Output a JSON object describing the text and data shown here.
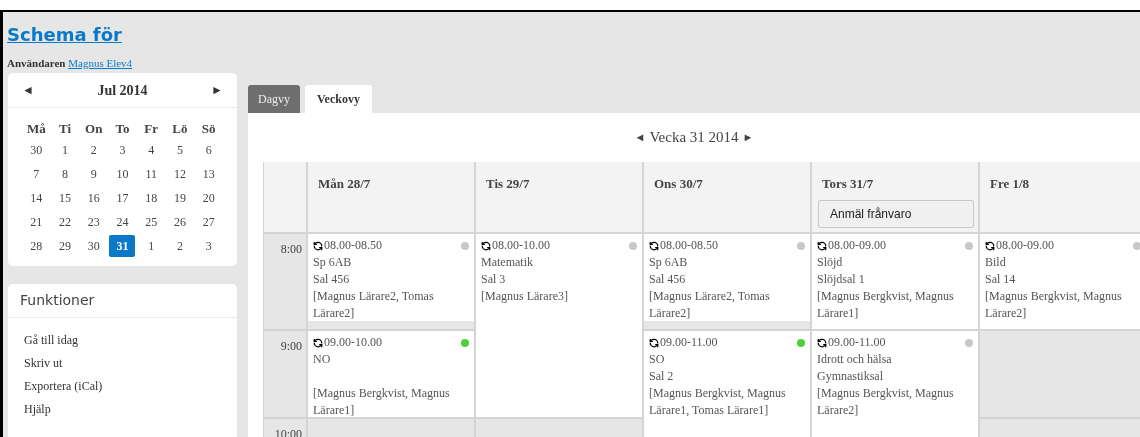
{
  "page": {
    "title": "Schema för",
    "user_label": "Användaren",
    "user_link": "Magnus Elev4"
  },
  "mini_calendar": {
    "prev": "◄",
    "month": "Jul 2014",
    "next": "►",
    "weekdays": [
      "Må",
      "Ti",
      "On",
      "To",
      "Fr",
      "Lö",
      "Sö"
    ],
    "weeks": [
      [
        {
          "day": "30",
          "selected": false
        },
        {
          "day": "1",
          "selected": false
        },
        {
          "day": "2",
          "selected": false
        },
        {
          "day": "3",
          "selected": false
        },
        {
          "day": "4",
          "selected": false
        },
        {
          "day": "5",
          "selected": false
        },
        {
          "day": "6",
          "selected": false
        }
      ],
      [
        {
          "day": "7",
          "selected": false
        },
        {
          "day": "8",
          "selected": false
        },
        {
          "day": "9",
          "selected": false
        },
        {
          "day": "10",
          "selected": false
        },
        {
          "day": "11",
          "selected": false
        },
        {
          "day": "12",
          "selected": false
        },
        {
          "day": "13",
          "selected": false
        }
      ],
      [
        {
          "day": "14",
          "selected": false
        },
        {
          "day": "15",
          "selected": false
        },
        {
          "day": "16",
          "selected": false
        },
        {
          "day": "17",
          "selected": false
        },
        {
          "day": "18",
          "selected": false
        },
        {
          "day": "19",
          "selected": false
        },
        {
          "day": "20",
          "selected": false
        }
      ],
      [
        {
          "day": "21",
          "selected": false
        },
        {
          "day": "22",
          "selected": false
        },
        {
          "day": "23",
          "selected": false
        },
        {
          "day": "24",
          "selected": false
        },
        {
          "day": "25",
          "selected": false
        },
        {
          "day": "26",
          "selected": false
        },
        {
          "day": "27",
          "selected": false
        }
      ],
      [
        {
          "day": "28",
          "selected": false
        },
        {
          "day": "29",
          "selected": false
        },
        {
          "day": "30",
          "selected": false
        },
        {
          "day": "31",
          "selected": true
        },
        {
          "day": "1",
          "selected": false
        },
        {
          "day": "2",
          "selected": false
        },
        {
          "day": "3",
          "selected": false
        }
      ]
    ]
  },
  "functions": {
    "title": "Funktioner",
    "items": [
      "Gå till idag",
      "Skriv ut",
      "Exportera (iCal)",
      "Hjälp"
    ]
  },
  "tabs": [
    {
      "label": "Dagvy",
      "selected": false
    },
    {
      "label": "Veckovy",
      "selected": true
    }
  ],
  "week_nav": {
    "prev": "◄",
    "label": "Vecka 31 2014",
    "next": "►"
  },
  "times": [
    "8:00",
    "9:00",
    "10:00"
  ],
  "days": [
    {
      "label": "Mån 28/7",
      "slots": [
        {
          "kind": "short",
          "time": "08.00-08.50",
          "subject": "Sp 6AB",
          "room": "Sal 456",
          "teachers": "[Magnus Lärare2, Tomas Lärare2]",
          "color": "#c8c8c8"
        },
        {
          "kind": "full",
          "time": "09.00-10.00",
          "subject": "NO",
          "teachers": "[Magnus Bergkvist, Magnus Lärare1]",
          "color": "#4cd137"
        },
        {
          "kind": "free"
        }
      ]
    },
    {
      "label": "Tis 29/7",
      "slots": [
        {
          "kind": "long",
          "time": "08.00-10.00",
          "subject": "Matematik",
          "room": "Sal 3",
          "teachers": "[Magnus Lärare3]",
          "color": "#c8c8c8"
        },
        {
          "kind": "free"
        }
      ]
    },
    {
      "label": "Ons 30/7",
      "slots": [
        {
          "kind": "short",
          "time": "08.00-08.50",
          "subject": "Sp 6AB",
          "room": "Sal 456",
          "teachers": "[Magnus Lärare2, Tomas Lärare2]",
          "color": "#c8c8c8"
        },
        {
          "kind": "long",
          "time": "09.00-11.00",
          "subject": "SO",
          "room": "Sal 2",
          "teachers": "[Magnus Bergkvist, Magnus Lärare1, Tomas Lärare1]",
          "color": "#4cd137"
        }
      ]
    },
    {
      "label": "Tors 31/7",
      "button": "Anmäl frånvaro",
      "slots": [
        {
          "kind": "full",
          "time": "08.00-09.00",
          "subject": "Slöjd",
          "room": "Slöjdsal 1",
          "teachers": "[Magnus Bergkvist, Magnus Lärare1]",
          "color": "#c8c8c8"
        },
        {
          "kind": "long",
          "time": "09.00-11.00",
          "subject": "Idrott och hälsa",
          "room": "Gymnastiksal",
          "teachers": "[Magnus Bergkvist, Magnus Lärare2]",
          "color": "#c8c8c8"
        }
      ]
    },
    {
      "label": "Fre 1/8",
      "slots": [
        {
          "kind": "full",
          "time": "08.00-09.00",
          "subject": "Bild",
          "room": "Sal 14",
          "teachers": "[Magnus Bergkvist, Magnus Lärare2]",
          "color": "#c8c8c8"
        },
        {
          "kind": "free"
        },
        {
          "kind": "free"
        }
      ]
    }
  ]
}
